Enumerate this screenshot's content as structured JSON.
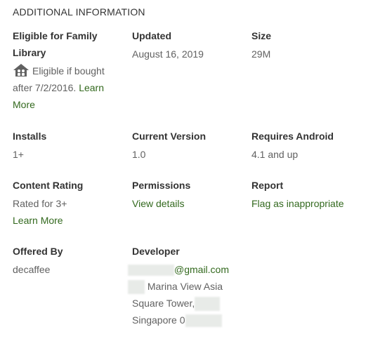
{
  "section": {
    "title": "ADDITIONAL INFORMATION"
  },
  "family_library": {
    "label_line1": "Eligible for Family",
    "label_line2": "Library",
    "icon": "family-house-icon",
    "text_line1": "Eligible if bought",
    "text_line2": "after 7/2/2016.",
    "link_part1": "Learn",
    "link_part2": "More"
  },
  "updated": {
    "label": "Updated",
    "value": "August 16, 2019"
  },
  "size": {
    "label": "Size",
    "value": "29M"
  },
  "installs": {
    "label": "Installs",
    "value": "1+"
  },
  "current_version": {
    "label": "Current Version",
    "value": "1.0"
  },
  "requires_android": {
    "label": "Requires Android",
    "value": "4.1 and up"
  },
  "content_rating": {
    "label": "Content Rating",
    "value": "Rated for 3+",
    "link": "Learn More"
  },
  "permissions": {
    "label": "Permissions",
    "link": "View details"
  },
  "report": {
    "label": "Report",
    "link": "Flag as inappropriate"
  },
  "offered_by": {
    "label": "Offered By",
    "value": "decaffee"
  },
  "developer": {
    "label": "Developer",
    "email_suffix": "@gmail.com",
    "address_line1": "Marina View Asia",
    "address_line2": "Square Tower,",
    "address_line3": "Singapore 0"
  },
  "colors": {
    "link": "#33691e",
    "label": "#333333",
    "value": "#616161"
  }
}
